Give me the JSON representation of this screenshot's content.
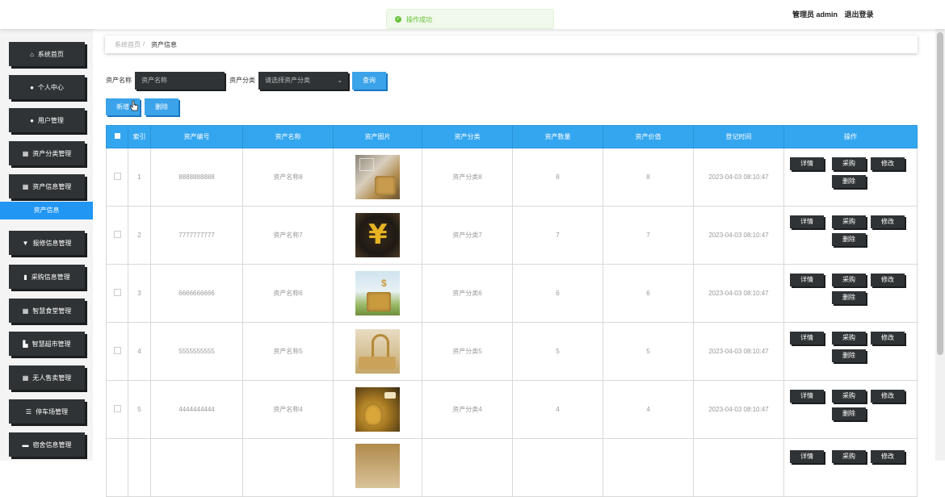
{
  "toast": {
    "message": "操作成功",
    "icon": "check-circle-icon"
  },
  "header": {
    "user_label": "管理员 admin",
    "logout_label": "退出登录"
  },
  "sidebar": {
    "items": [
      {
        "label": "系统首页",
        "icon": "home-icon"
      },
      {
        "label": "个人中心",
        "icon": "user-icon"
      },
      {
        "label": "用户管理",
        "icon": "user-icon"
      },
      {
        "label": "资产分类管理",
        "icon": "grid-icon"
      },
      {
        "label": "资产信息管理",
        "icon": "grid-icon"
      },
      {
        "label": "报修信息管理",
        "icon": "filter-icon"
      },
      {
        "label": "采购信息管理",
        "icon": "clipboard-icon"
      },
      {
        "label": "智慧食堂管理",
        "icon": "grid-icon"
      },
      {
        "label": "智慧超市管理",
        "icon": "store-icon"
      },
      {
        "label": "无人售卖管理",
        "icon": "grid-icon"
      },
      {
        "label": "停车场管理",
        "icon": "list-icon"
      },
      {
        "label": "宿舍信息管理",
        "icon": "bed-icon"
      }
    ],
    "active_submenu": "资产信息"
  },
  "breadcrumb": {
    "home": "系统首页",
    "separator": "/",
    "current": "资产信息"
  },
  "search": {
    "name_label": "资产名称",
    "name_placeholder": "资产名称",
    "category_label": "资产分类",
    "category_placeholder": "请选择资产分类",
    "search_button": "查询"
  },
  "actions": {
    "add_button": "新增",
    "delete_button": "删除"
  },
  "table": {
    "headers": [
      "索引",
      "资产编号",
      "资产名称",
      "资产图片",
      "资产分类",
      "资产数量",
      "资产价值",
      "登记时间",
      "操作"
    ],
    "op_labels": {
      "detail": "详情",
      "purchase": "采购",
      "edit": "修改",
      "delete": "删除"
    },
    "rows": [
      {
        "index": "1",
        "code": "8888888888",
        "name": "资产名称8",
        "category": "资产分类8",
        "quantity": "8",
        "value": "8",
        "time": "2023-04-03 08:10:47"
      },
      {
        "index": "2",
        "code": "7777777777",
        "name": "资产名称7",
        "category": "资产分类7",
        "quantity": "7",
        "value": "7",
        "time": "2023-04-03 08:10:47"
      },
      {
        "index": "3",
        "code": "6666666666",
        "name": "资产名称6",
        "category": "资产分类6",
        "quantity": "6",
        "value": "6",
        "time": "2023-04-03 08:10:47"
      },
      {
        "index": "4",
        "code": "5555555555",
        "name": "资产名称5",
        "category": "资产分类5",
        "quantity": "5",
        "value": "5",
        "time": "2023-04-03 08:10:47"
      },
      {
        "index": "5",
        "code": "4444444444",
        "name": "资产名称4",
        "category": "资产分类4",
        "quantity": "4",
        "value": "4",
        "time": "2023-04-03 08:10:47"
      },
      {
        "index": "",
        "code": "",
        "name": "",
        "category": "",
        "quantity": "",
        "value": "",
        "time": ""
      }
    ]
  },
  "colors": {
    "accent": "#34a6f0",
    "dark": "#2f3335",
    "success": "#67c23a"
  }
}
